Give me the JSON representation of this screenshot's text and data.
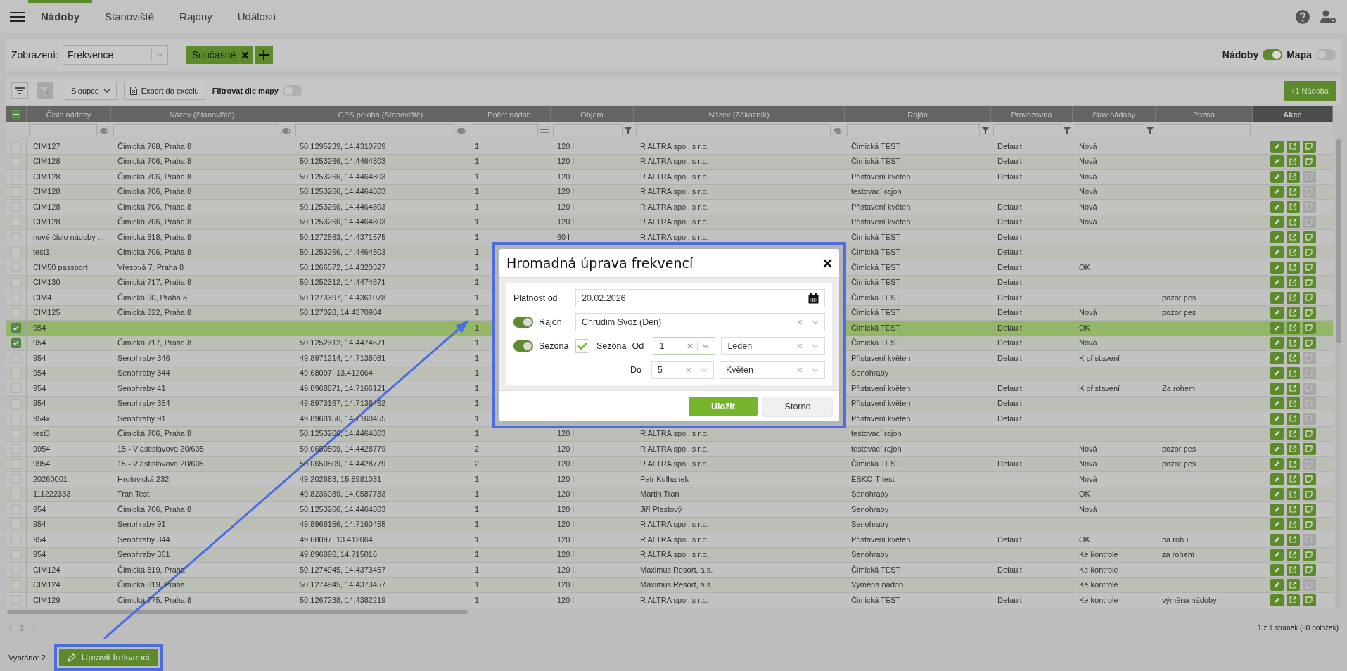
{
  "nav": {
    "tabs": [
      {
        "label": "Nádoby",
        "selected": true
      },
      {
        "label": "Stanoviště",
        "selected": false
      },
      {
        "label": "Rajóny",
        "selected": false
      },
      {
        "label": "Události",
        "selected": false
      }
    ]
  },
  "view_bar": {
    "label": "Zobrazení:",
    "view_select": "Frekvence",
    "chip": "Současné",
    "toggles": [
      {
        "label": "Nádoby",
        "on": true
      },
      {
        "label": "Mapa",
        "on": false
      }
    ]
  },
  "toolbar": {
    "columns_button": "Sloupce",
    "export_button": "Export do excelu",
    "map_filter": {
      "label": "Filtrovat dle mapy",
      "on": false
    },
    "add_button": "+1 Nádoba"
  },
  "table": {
    "select_all": {
      "indeterminate": true
    },
    "actions_header": "Akce",
    "columns": [
      {
        "label": "Číslo nádoby",
        "kind": "text"
      },
      {
        "label": "Název (Stanoviště)",
        "kind": "text"
      },
      {
        "label": "GPS poloha (Stanoviště)",
        "kind": "text"
      },
      {
        "label": "Počet nádob",
        "kind": "number"
      },
      {
        "label": "Objem",
        "kind": "list"
      },
      {
        "label": "Název (Zákazník)",
        "kind": "text"
      },
      {
        "label": "Rajón",
        "kind": "list"
      },
      {
        "label": "Provozovna",
        "kind": "list"
      },
      {
        "label": "Stav nádoby",
        "kind": "list"
      },
      {
        "label": "Pozná",
        "kind": "plain"
      }
    ],
    "rows": [
      {
        "no": "CIM127",
        "site": "Čimická 768, Praha 8",
        "gps": "50.1295239, 14.4310709",
        "count": "1",
        "volume": "120 l",
        "customer": "R ALTRA spol. s r.o.",
        "district": "Čimická TEST",
        "plant": "Default",
        "status": "Nová",
        "checked": false,
        "active": false,
        "note_action_enabled": true
      },
      {
        "no": "CIM128",
        "site": "Čimická 706, Praha 8",
        "gps": "50.1253266, 14.4464803",
        "count": "1",
        "volume": "120 l",
        "customer": "R ALTRA spol. s r.o.",
        "district": "Čimická TEST",
        "plant": "Default",
        "status": "Nová",
        "checked": false,
        "active": false,
        "note_action_enabled": true
      },
      {
        "no": "CIM128",
        "site": "Čimická 706, Praha 8",
        "gps": "50.1253266, 14.4464803",
        "count": "1",
        "volume": "120 l",
        "customer": "R ALTRA spol. s r.o.",
        "district": "Přistavení květen",
        "plant": "Default",
        "status": "Nová",
        "checked": false,
        "active": false,
        "note_action_enabled": false
      },
      {
        "no": "CIM128",
        "site": "Čimická 706, Praha 8",
        "gps": "50.1253266, 14.4464803",
        "count": "1",
        "volume": "120 l",
        "customer": "R ALTRA spol. s r.o.",
        "district": "testovací rajon",
        "status": "Nová",
        "checked": false,
        "active": false,
        "note_action_enabled": false
      },
      {
        "no": "CIM128",
        "site": "Čimická 706, Praha 8",
        "gps": "50.1253266, 14.4464803",
        "count": "1",
        "volume": "120 l",
        "customer": "R ALTRA spol. s r.o.",
        "district": "Přistavení květen",
        "plant": "Default",
        "status": "Nová",
        "checked": false,
        "active": false,
        "note_action_enabled": false
      },
      {
        "no": "CIM128",
        "site": "Čimická 706, Praha 8",
        "gps": "50.1253266, 14.4464803",
        "count": "1",
        "volume": "120 l",
        "customer": "R ALTRA spol. s r.o.",
        "district": "Přistavení květen",
        "plant": "Default",
        "status": "Nová",
        "checked": false,
        "active": false,
        "note_action_enabled": false
      },
      {
        "no": "nové číslo nádoby ...",
        "site": "Čimická 818, Praha 8",
        "gps": "50.1272563, 14.4371575",
        "count": "1",
        "volume": "60 l",
        "customer": "R ALTRA spol. s r.o.",
        "district": "Čimická TEST",
        "plant": "Default",
        "checked": false,
        "active": false,
        "note_action_enabled": true
      },
      {
        "no": "test1",
        "site": "Čimická 706, Praha 8",
        "gps": "50.1253266, 14.4464803",
        "count": "1",
        "district": "Čimická TEST",
        "plant": "Default",
        "checked": false,
        "active": false,
        "note_action_enabled": true
      },
      {
        "no": "CIM50 passport",
        "site": "Vřesová 7, Praha 8",
        "gps": "50.1266572, 14.4320327",
        "count": "1",
        "district": "Čimická TEST",
        "plant": "Default",
        "status": "OK",
        "checked": false,
        "active": false,
        "note_action_enabled": true
      },
      {
        "no": "CIM130",
        "site": "Čimická 717, Praha 8",
        "gps": "50.1252312, 14.4474671",
        "count": "1",
        "district": "Čimická TEST",
        "plant": "Default",
        "checked": false,
        "active": false,
        "note_action_enabled": true
      },
      {
        "no": "CIM4",
        "site": "Čimická 90, Praha 8",
        "gps": "50.1273397, 14.4361078",
        "count": "1",
        "district": "Čimická TEST",
        "plant": "Default",
        "note": "pozor pes",
        "checked": false,
        "active": false,
        "note_action_enabled": true
      },
      {
        "no": "CIM125",
        "site": "Čimická 822, Praha 8",
        "gps": "50.127028, 14.4370904",
        "count": "1",
        "district": "Čimická TEST",
        "plant": "Default",
        "status": "Nová",
        "note": "pozor pes",
        "checked": false,
        "active": false,
        "note_action_enabled": true
      },
      {
        "no": "954",
        "count": "1",
        "district": "Čimická TEST",
        "plant": "Default",
        "status": "OK",
        "checked": true,
        "active": true,
        "note_action_enabled": true
      },
      {
        "no": "954",
        "site": "Čimická 717, Praha 8",
        "gps": "50.1252312, 14.4474671",
        "count": "1",
        "district": "Čimická TEST",
        "plant": "Default",
        "status": "Nová",
        "checked": true,
        "active": false,
        "note_action_enabled": true
      },
      {
        "no": "954",
        "site": "Senohraby 346",
        "gps": "49.8971214, 14.7138081",
        "count": "1",
        "district": "Přistavení květen",
        "plant": "Default",
        "status": "K přistavení",
        "checked": false,
        "active": false,
        "note_action_enabled": false
      },
      {
        "no": "954",
        "site": "Senohraby 344",
        "gps": "49.68097, 13.412064",
        "count": "1",
        "district": "Senohraby",
        "checked": false,
        "active": false,
        "note_action_enabled": false
      },
      {
        "no": "954",
        "site": "Senohraby 41",
        "gps": "49.8968871, 14.7166121",
        "count": "1",
        "district": "Přistavení květen",
        "plant": "Default",
        "status": "K přistavení",
        "note": "Za rohem",
        "checked": false,
        "active": false,
        "note_action_enabled": false
      },
      {
        "no": "954",
        "site": "Senohraby 354",
        "gps": "49.8973167, 14.7138462",
        "count": "1",
        "district": "Přistavení květen",
        "plant": "Default",
        "checked": false,
        "active": false,
        "note_action_enabled": false
      },
      {
        "no": "954x",
        "site": "Senohraby 91",
        "gps": "49.8968156, 14.7160455",
        "count": "1",
        "district": "Přistavení květen",
        "plant": "Default",
        "checked": false,
        "active": false,
        "note_action_enabled": false
      },
      {
        "no": "test3",
        "site": "Čimická 706, Praha 8",
        "gps": "50.1253266, 14.4464803",
        "count": "1",
        "volume": "120 l",
        "customer": "R ALTRA spol. s r.o.",
        "district": "testovací rajon",
        "checked": false,
        "active": false,
        "note_action_enabled": true
      },
      {
        "no": "9954",
        "site": "15 - Vlastislavova 20/605",
        "gps": "50.0650509, 14.4428779",
        "count": "2",
        "volume": "120 l",
        "customer": "R ALTRA spol. s r.o.",
        "district": "testovací rajon",
        "status": "Nová",
        "note": "pozor pes",
        "checked": false,
        "active": false,
        "note_action_enabled": true
      },
      {
        "no": "9954",
        "site": "15 - Vlastislavova 20/605",
        "gps": "50.0650509, 14.4428779",
        "count": "2",
        "volume": "120 l",
        "customer": "R ALTRA spol. s r.o.",
        "district": "Čimická TEST",
        "plant": "Default",
        "status": "Nová",
        "note": "pozor pes",
        "checked": false,
        "active": false,
        "note_action_enabled": false
      },
      {
        "no": "20260001",
        "site": "Hrotovická 232",
        "gps": "49.202683, 15.8981031",
        "count": "1",
        "volume": "120 l",
        "customer": "Petr Kulhanek",
        "district": "ESKO-T test",
        "status": "Nová",
        "checked": false,
        "active": false,
        "note_action_enabled": true
      },
      {
        "no": "111222333",
        "site": "Tran Test",
        "gps": "49.8236089, 14.0587783",
        "count": "1",
        "volume": "120 l",
        "customer": "Martin Tran",
        "district": "Senohraby",
        "status": "OK",
        "checked": false,
        "active": false,
        "note_action_enabled": true
      },
      {
        "no": "954",
        "site": "Čimická 706, Praha 8",
        "gps": "50.1253266, 14.4464803",
        "count": "1",
        "volume": "120 l",
        "customer": "Jiří Plastový",
        "district": "Senohraby",
        "status": "Nová",
        "checked": false,
        "active": false,
        "note_action_enabled": true
      },
      {
        "no": "954",
        "site": "Senohraby 91",
        "gps": "49.8968156, 14.7160455",
        "count": "1",
        "volume": "120 l",
        "customer": "R ALTRA spol. s r.o.",
        "district": "Senohraby",
        "checked": false,
        "active": false,
        "note_action_enabled": true
      },
      {
        "no": "954",
        "site": "Senohraby 344",
        "gps": "49.68097, 13.412064",
        "count": "1",
        "volume": "120 l",
        "customer": "R ALTRA spol. s r.o.",
        "district": "Přistavení květen",
        "plant": "Default",
        "status": "OK",
        "note": "na rohu",
        "checked": false,
        "active": false,
        "note_action_enabled": false
      },
      {
        "no": "954",
        "site": "Senohraby 361",
        "gps": "49.896896, 14.715016",
        "count": "1",
        "volume": "120 l",
        "customer": "R ALTRA spol. s r.o.",
        "district": "Senohraby",
        "status": "Ke kontrole",
        "note": "za rohem",
        "checked": false,
        "active": false,
        "note_action_enabled": true
      },
      {
        "no": "CIM124",
        "site": "Čimická 819, Praha",
        "gps": "50.1274945, 14.4373457",
        "count": "1",
        "volume": "120 l",
        "customer": "Maximus Resort, a.s.",
        "district": "Čimická TEST",
        "plant": "Default",
        "status": "Ke kontrole",
        "checked": false,
        "active": false,
        "note_action_enabled": true
      },
      {
        "no": "CIM124",
        "site": "Čimická 819, Praha",
        "gps": "50.1274945, 14.4373457",
        "count": "1",
        "volume": "120 l",
        "customer": "Maximus Resort, a.s.",
        "district": "Výměna nádob",
        "status": "Ke kontrole",
        "checked": false,
        "active": false,
        "note_action_enabled": false
      },
      {
        "no": "CIM129",
        "site": "Čimická 775, Praha 8",
        "gps": "50.1267238, 14.4382219",
        "count": "1",
        "volume": "120 l",
        "customer": "R ALTRA spol. s r.o.",
        "district": "Čimická TEST",
        "plant": "Default",
        "status": "Ke kontrole",
        "note": "výměna nádoby",
        "checked": false,
        "active": false,
        "note_action_enabled": true
      }
    ]
  },
  "pagination": {
    "page": "1",
    "summary": "1 z 1 stránek (60 položek)"
  },
  "footer": {
    "selected_label": "Vybráno: 2",
    "edit_button": "Upravit frekvenci"
  },
  "dialog": {
    "title": "Hromadná úprava frekvencí",
    "valid_from": {
      "label": "Platnost od",
      "value": "20.02.2026"
    },
    "district": {
      "label": "Rajón",
      "on": true,
      "value": "Chrudim Svoz (Den)"
    },
    "season": {
      "label": "Sezóna",
      "on": true,
      "checkbox_label": "Sezóna",
      "checked": true,
      "from_label": "Od",
      "from_day": "1",
      "from_month": "Leden",
      "to_label": "Do",
      "to_day": "5",
      "to_month": "Květen"
    },
    "buttons": [
      {
        "label": "Uložit",
        "kind": "primary"
      },
      {
        "label": "Storno",
        "kind": "secondary"
      }
    ]
  }
}
